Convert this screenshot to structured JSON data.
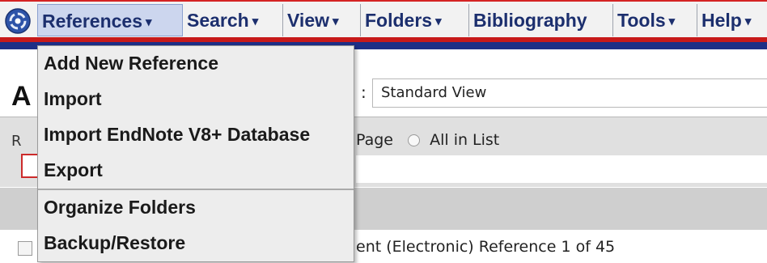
{
  "menubar": {
    "logo_icon": "app-globe-icon",
    "caret": "▾",
    "menus": [
      {
        "label": "References"
      },
      {
        "label": "Search"
      },
      {
        "label": "View"
      },
      {
        "label": "Folders"
      },
      {
        "label": "Bibliography"
      },
      {
        "label": "Tools"
      },
      {
        "label": "Help"
      }
    ]
  },
  "references_menu": {
    "items": [
      {
        "label": "Add New Reference"
      },
      {
        "label": "Import"
      },
      {
        "label": "Import EndNote V8+ Database"
      },
      {
        "label": "Export"
      },
      {
        "label": "Organize Folders"
      },
      {
        "label": "Backup/Restore"
      }
    ]
  },
  "page": {
    "heading_fragment": "A",
    "view_colon": ":",
    "view_select_value": "Standard View",
    "left_label_fragment": "R",
    "radio_page_fragment": "Page",
    "radio_all": "All in List",
    "reference_info_fragment": "ent (Electronic) Reference 1 of 45"
  },
  "colors": {
    "menubar_top_border": "#d42323",
    "menu_text": "#1c2f6e",
    "active_menu_bg": "#ccd6ee",
    "red_stripe": "#c71a1a",
    "blue_stripe": "#1d2f86"
  }
}
